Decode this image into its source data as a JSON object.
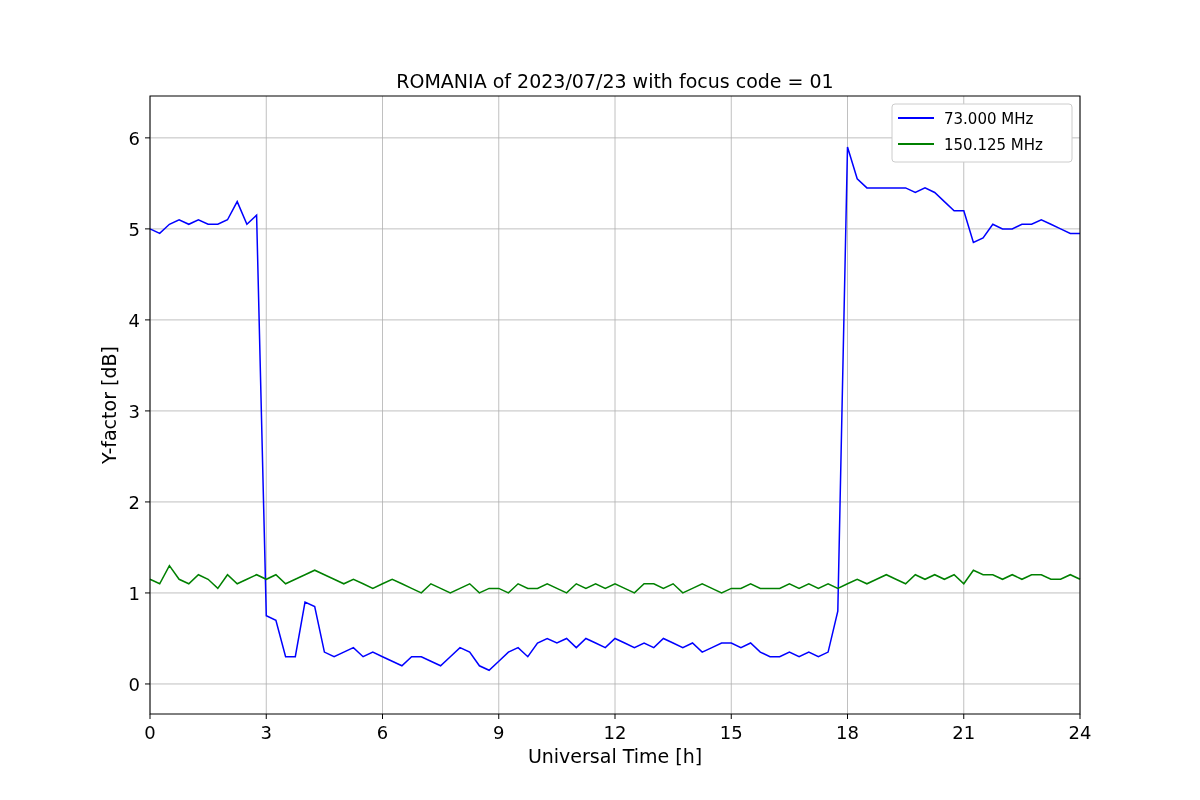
{
  "figure": {
    "chart_data": {
      "type": "line",
      "title": "ROMANIA of 2023/07/23 with focus code = 01",
      "xlabel": "Universal Time [h]",
      "ylabel": "Y-factor [dB]",
      "x": [
        0,
        0.25,
        0.5,
        0.75,
        1,
        1.25,
        1.5,
        1.75,
        2,
        2.25,
        2.5,
        2.75,
        3,
        3.25,
        3.5,
        3.75,
        4,
        4.25,
        4.5,
        4.75,
        5,
        5.25,
        5.5,
        5.75,
        6,
        6.25,
        6.5,
        6.75,
        7,
        7.25,
        7.5,
        7.75,
        8,
        8.25,
        8.5,
        8.75,
        9,
        9.25,
        9.5,
        9.75,
        10,
        10.25,
        10.5,
        10.75,
        11,
        11.25,
        11.5,
        11.75,
        12,
        12.25,
        12.5,
        12.75,
        13,
        13.25,
        13.5,
        13.75,
        14,
        14.25,
        14.5,
        14.75,
        15,
        15.25,
        15.5,
        15.75,
        16,
        16.25,
        16.5,
        16.75,
        17,
        17.25,
        17.5,
        17.75,
        18,
        18.25,
        18.5,
        18.75,
        19,
        19.25,
        19.5,
        19.75,
        20,
        20.25,
        20.5,
        20.75,
        21,
        21.25,
        21.5,
        21.75,
        22,
        22.25,
        22.5,
        22.75,
        23,
        23.25,
        23.5,
        23.75,
        24
      ],
      "series": [
        {
          "name": "73.000 MHz",
          "color": "#0000ff",
          "values": [
            5.0,
            4.95,
            5.05,
            5.1,
            5.05,
            5.1,
            5.05,
            5.05,
            5.1,
            5.3,
            5.05,
            5.15,
            0.75,
            0.7,
            0.3,
            0.3,
            0.9,
            0.85,
            0.35,
            0.3,
            0.35,
            0.4,
            0.3,
            0.35,
            0.3,
            0.25,
            0.2,
            0.3,
            0.3,
            0.25,
            0.2,
            0.3,
            0.4,
            0.35,
            0.2,
            0.15,
            0.25,
            0.35,
            0.4,
            0.3,
            0.45,
            0.5,
            0.45,
            0.5,
            0.4,
            0.5,
            0.45,
            0.4,
            0.5,
            0.45,
            0.4,
            0.45,
            0.4,
            0.5,
            0.45,
            0.4,
            0.45,
            0.35,
            0.4,
            0.45,
            0.45,
            0.4,
            0.45,
            0.35,
            0.3,
            0.3,
            0.35,
            0.3,
            0.35,
            0.3,
            0.35,
            0.8,
            5.9,
            5.55,
            5.45,
            5.45,
            5.45,
            5.45,
            5.45,
            5.4,
            5.45,
            5.4,
            5.3,
            5.2,
            5.2,
            4.85,
            4.9,
            5.05,
            5.0,
            5.0,
            5.05,
            5.05,
            5.1,
            5.05,
            5.0,
            4.95,
            4.95
          ]
        },
        {
          "name": "150.125 MHz",
          "color": "#008000",
          "values": [
            1.15,
            1.1,
            1.3,
            1.15,
            1.1,
            1.2,
            1.15,
            1.05,
            1.2,
            1.1,
            1.15,
            1.2,
            1.15,
            1.2,
            1.1,
            1.15,
            1.2,
            1.25,
            1.2,
            1.15,
            1.1,
            1.15,
            1.1,
            1.05,
            1.1,
            1.15,
            1.1,
            1.05,
            1.0,
            1.1,
            1.05,
            1.0,
            1.05,
            1.1,
            1.0,
            1.05,
            1.05,
            1.0,
            1.1,
            1.05,
            1.05,
            1.1,
            1.05,
            1.0,
            1.1,
            1.05,
            1.1,
            1.05,
            1.1,
            1.05,
            1.0,
            1.1,
            1.1,
            1.05,
            1.1,
            1.0,
            1.05,
            1.1,
            1.05,
            1.0,
            1.05,
            1.05,
            1.1,
            1.05,
            1.05,
            1.05,
            1.1,
            1.05,
            1.1,
            1.05,
            1.1,
            1.05,
            1.1,
            1.15,
            1.1,
            1.15,
            1.2,
            1.15,
            1.1,
            1.2,
            1.15,
            1.2,
            1.15,
            1.2,
            1.1,
            1.25,
            1.2,
            1.2,
            1.15,
            1.2,
            1.15,
            1.2,
            1.2,
            1.15,
            1.15,
            1.2,
            1.15
          ]
        }
      ],
      "xlim": [
        0,
        24
      ],
      "ylim": [
        -0.33,
        6.46
      ],
      "xticks": [
        0,
        3,
        6,
        9,
        12,
        15,
        18,
        21,
        24
      ],
      "yticks": [
        0,
        1,
        2,
        3,
        4,
        5,
        6
      ],
      "grid": true,
      "legend": true
    }
  }
}
